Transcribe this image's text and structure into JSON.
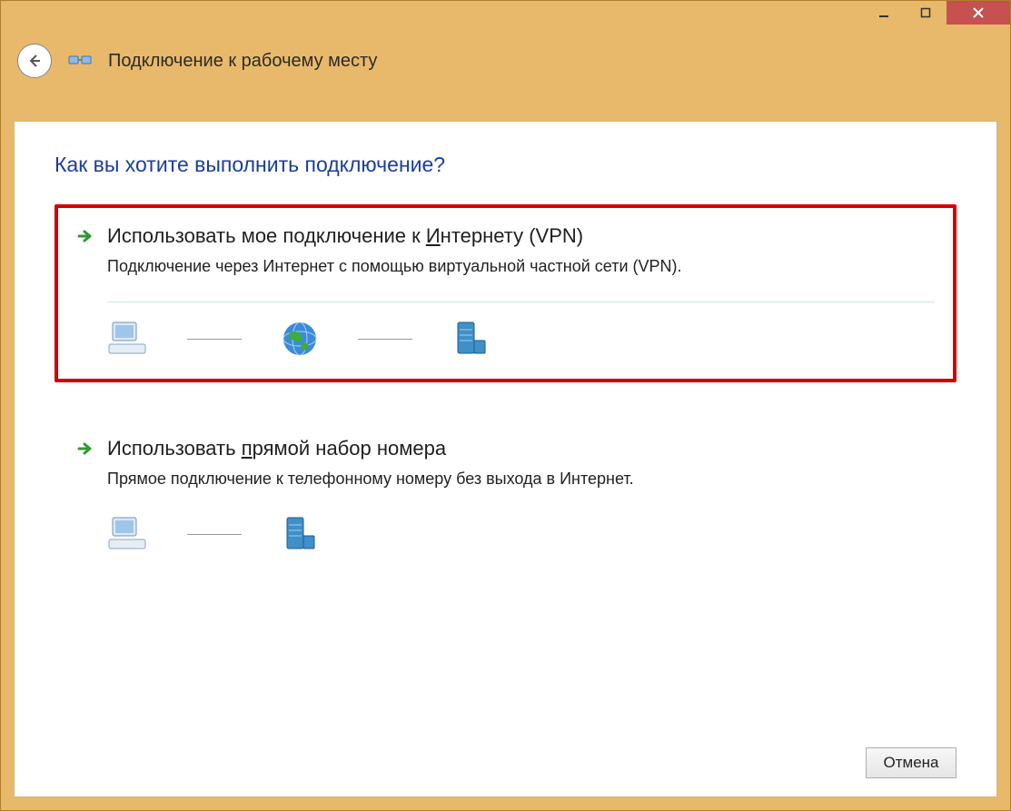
{
  "header": {
    "title": "Подключение к рабочему месту"
  },
  "question": "Как вы хотите выполнить подключение?",
  "options": {
    "vpn": {
      "title_pre": "Использовать мое подключение к ",
      "title_underline": "И",
      "title_post": "нтернету (VPN)",
      "desc": "Подключение через Интернет с помощью виртуальной частной сети (VPN)."
    },
    "dial": {
      "title_pre": "Использовать ",
      "title_underline": "п",
      "title_post": "рямой набор номера",
      "desc": "Прямое подключение к телефонному номеру без выхода в Интернет."
    }
  },
  "footer": {
    "cancel": "Отмена"
  }
}
